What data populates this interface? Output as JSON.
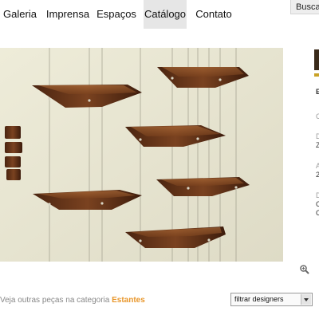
{
  "nav": {
    "items": [
      {
        "label": "Galeria",
        "active": false
      },
      {
        "label": "Imprensa",
        "active": false
      },
      {
        "label": "Espaços",
        "active": false
      },
      {
        "label": "Catálogo",
        "active": true
      },
      {
        "label": "Contato",
        "active": false
      }
    ],
    "search_label": "Busca"
  },
  "photo": {
    "subject": "suspended wooden boat-shaped shelves",
    "background_color": "#e8e6d3",
    "wood_color": "#6b3a1e"
  },
  "side_panel": {
    "fragments": [
      "E",
      "C",
      "D",
      "Z",
      "A",
      "2",
      "D",
      "C",
      "C"
    ]
  },
  "related": {
    "prefix": "Veja outras peças na categoria",
    "category": "Estantes",
    "category_color": "#e8962a"
  },
  "filter": {
    "selected": "filtrar designers"
  },
  "icons": {
    "zoom": "zoom-icon",
    "dropdown": "chevron-down-icon"
  }
}
